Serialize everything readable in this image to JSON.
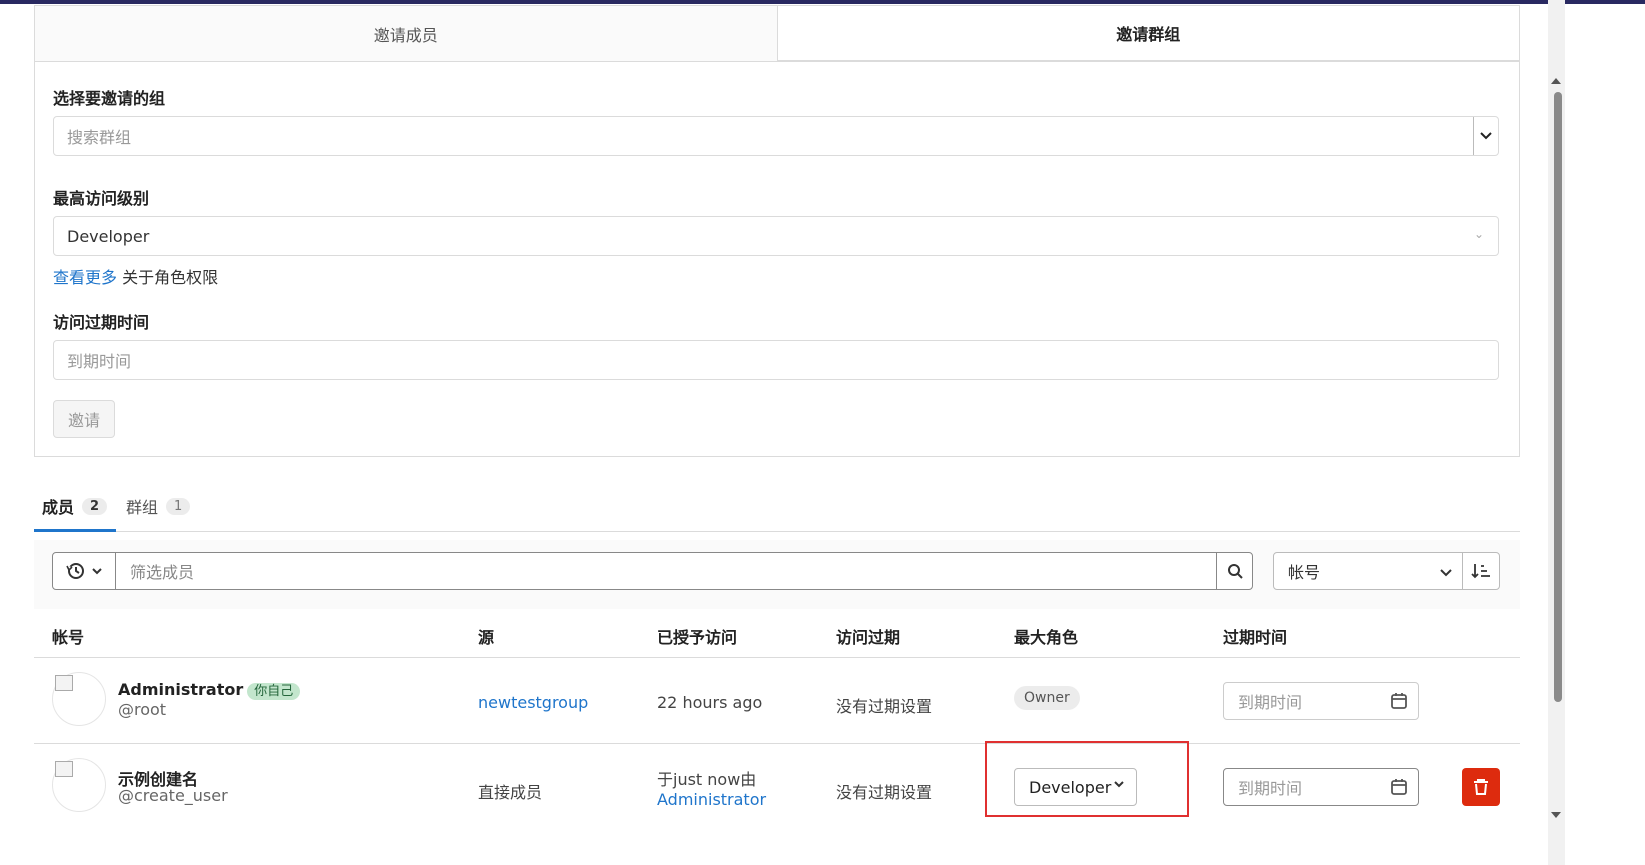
{
  "invite_tabs": [
    {
      "label": "邀请成员"
    },
    {
      "label": "邀请群组"
    }
  ],
  "invite_form": {
    "group_label": "选择要邀请的组",
    "group_placeholder": "搜索群组",
    "access_label": "最高访问级别",
    "access_value": "Developer",
    "hint_link": "查看更多",
    "hint_text": "关于角色权限",
    "expiry_label": "访问过期时间",
    "expiry_placeholder": "到期时间",
    "invite_button": "邀请"
  },
  "member_tabs": [
    {
      "label": "成员",
      "count": "2"
    },
    {
      "label": "群组",
      "count": "1"
    }
  ],
  "filter": {
    "placeholder": "筛选成员",
    "sort_value": "帐号"
  },
  "table": {
    "headers": [
      "帐号",
      "源",
      "已授予访问",
      "访问过期",
      "最大角色",
      "过期时间"
    ],
    "rows": [
      {
        "name": "Administrator",
        "you_badge": "你自己",
        "handle": "@root",
        "source": "newtestgroup",
        "granted": "22 hours ago",
        "expires": "没有过期设置",
        "role": "Owner",
        "expiry_placeholder": "到期时间"
      },
      {
        "name": "示例创建名",
        "handle": "@create_user",
        "source": "直接成员",
        "granted_prefix": "于just now由",
        "granted_by": "Administrator",
        "expires": "没有过期设置",
        "role": "Developer",
        "expiry_placeholder": "到期时间"
      }
    ]
  },
  "colors": {
    "link": "#1f75cb",
    "danger": "#dd2b0e",
    "highlight": "#e03030",
    "you_badge_bg": "#c3e6cd"
  }
}
